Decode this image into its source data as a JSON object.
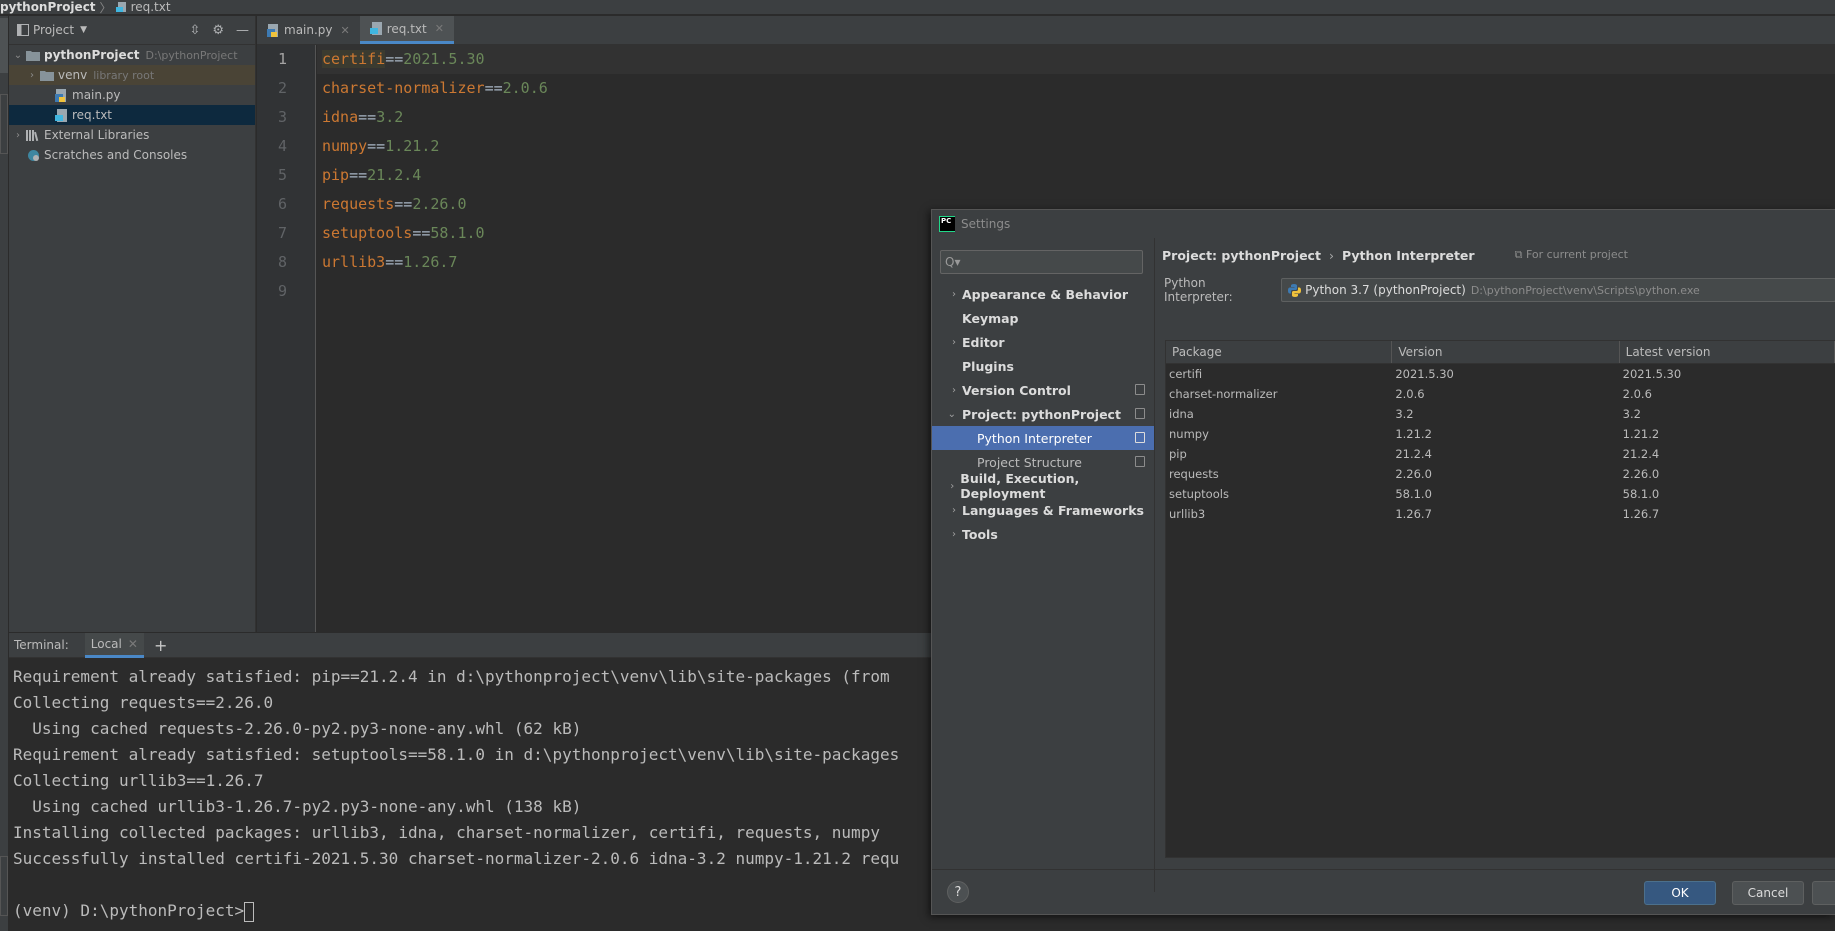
{
  "topbar": {
    "project": "pythonProject",
    "separator": "〉",
    "file": "req.txt"
  },
  "project_panel": {
    "title": "Project",
    "tree": [
      {
        "label": "pythonProject",
        "hint": "D:\\pythonProject"
      },
      {
        "label": "venv",
        "hint": "library root"
      },
      {
        "label": "main.py"
      },
      {
        "label": "req.txt"
      },
      {
        "label": "External Libraries"
      },
      {
        "label": "Scratches and Consoles"
      }
    ]
  },
  "editor": {
    "tabs": [
      {
        "label": "main.py"
      },
      {
        "label": "req.txt"
      }
    ],
    "line_numbers": [
      "1",
      "2",
      "3",
      "4",
      "5",
      "6",
      "7",
      "8",
      "9"
    ],
    "lines": [
      {
        "pkg": "certifi",
        "op": "==",
        "ver": "2021.5.30"
      },
      {
        "pkg": "charset-normalizer",
        "op": "==",
        "ver": "2.0.6"
      },
      {
        "pkg": "idna",
        "op": "==",
        "ver": "3.2"
      },
      {
        "pkg": "numpy",
        "op": "==",
        "ver": "1.21.2"
      },
      {
        "pkg": "pip",
        "op": "==",
        "ver": "21.2.4"
      },
      {
        "pkg": "requests",
        "op": "==",
        "ver": "2.26.0"
      },
      {
        "pkg": "setuptools",
        "op": "==",
        "ver": "58.1.0"
      },
      {
        "pkg": "urllib3",
        "op": "==",
        "ver": "1.26.7"
      }
    ]
  },
  "terminal": {
    "label": "Terminal:",
    "tab": "Local",
    "add": "+",
    "lines": [
      "Requirement already satisfied: pip==21.2.4 in d:\\pythonproject\\venv\\lib\\site-packages (from",
      "Collecting requests==2.26.0",
      "  Using cached requests-2.26.0-py2.py3-none-any.whl (62 kB)",
      "Requirement already satisfied: setuptools==58.1.0 in d:\\pythonproject\\venv\\lib\\site-packages",
      "Collecting urllib3==1.26.7",
      "  Using cached urllib3-1.26.7-py2.py3-none-any.whl (138 kB)",
      "Installing collected packages: urllib3, idna, charset-normalizer, certifi, requests, numpy",
      "Successfully installed certifi-2021.5.30 charset-normalizer-2.0.6 idna-3.2 numpy-1.21.2 requ",
      "",
      "(venv) D:\\pythonProject>"
    ]
  },
  "settings": {
    "title": "Settings",
    "search_placeholder": "Q▾",
    "nav": [
      {
        "label": "Appearance & Behavior",
        "arrow": "›"
      },
      {
        "label": "Keymap",
        "arrow": ""
      },
      {
        "label": "Editor",
        "arrow": "›"
      },
      {
        "label": "Plugins",
        "arrow": ""
      },
      {
        "label": "Version Control",
        "arrow": "›"
      },
      {
        "label": "Project: pythonProject",
        "arrow": "⌄"
      },
      {
        "label": "Python Interpreter",
        "arrow": ""
      },
      {
        "label": "Project Structure",
        "arrow": ""
      },
      {
        "label": "Build, Execution, Deployment",
        "arrow": "›"
      },
      {
        "label": "Languages & Frameworks",
        "arrow": "›"
      },
      {
        "label": "Tools",
        "arrow": "›"
      }
    ],
    "breadcrumb": {
      "parent": "Project: pythonProject",
      "sep": "›",
      "current": "Python Interpreter",
      "scope": "For current project"
    },
    "interpreter": {
      "label": "Python Interpreter:",
      "value": "Python 3.7 (pythonProject)",
      "path": "D:\\pythonProject\\venv\\Scripts\\python.exe"
    },
    "table": {
      "headers": [
        "Package",
        "Version",
        "Latest version"
      ],
      "rows": [
        [
          "certifi",
          "2021.5.30",
          "2021.5.30"
        ],
        [
          "charset-normalizer",
          "2.0.6",
          "2.0.6"
        ],
        [
          "idna",
          "3.2",
          "3.2"
        ],
        [
          "numpy",
          "1.21.2",
          "1.21.2"
        ],
        [
          "pip",
          "21.2.4",
          "21.2.4"
        ],
        [
          "requests",
          "2.26.0",
          "2.26.0"
        ],
        [
          "setuptools",
          "58.1.0",
          "58.1.0"
        ],
        [
          "urllib3",
          "1.26.7",
          "1.26.7"
        ]
      ]
    },
    "buttons": {
      "help": "?",
      "ok": "OK",
      "cancel": "Cancel"
    }
  }
}
